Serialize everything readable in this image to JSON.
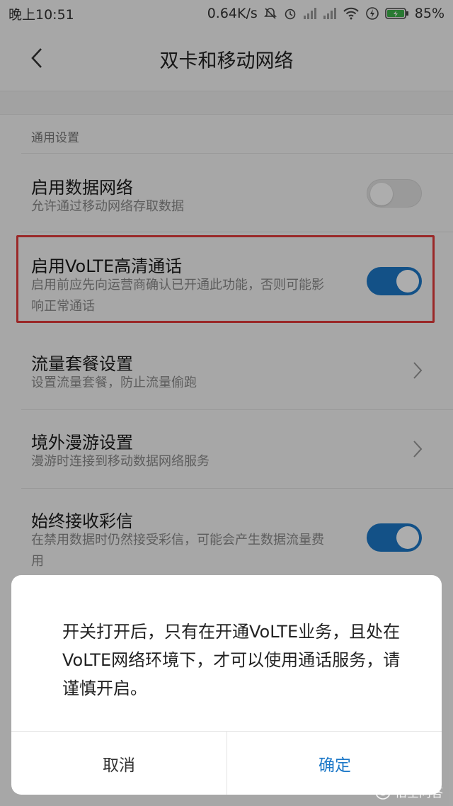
{
  "status_bar": {
    "time": "晚上10:51",
    "net_speed": "0.64K/s",
    "battery": "85%",
    "icons": [
      "mute-icon",
      "alarm-icon",
      "signal-icon",
      "signal-icon",
      "wifi-icon",
      "flash-icon",
      "battery-charging-icon"
    ]
  },
  "header": {
    "title": "双卡和移动网络",
    "back_icon": "chevron-left-icon"
  },
  "section": {
    "label": "通用设置"
  },
  "settings": {
    "data_network": {
      "title": "启用数据网络",
      "subtitle": "允许通过移动网络存取数据",
      "enabled": false
    },
    "volte": {
      "title": "启用VoLTE高清通话",
      "subtitle": "启用前应先向运营商确认已开通此功能，否则可能影响正常通话",
      "enabled": true
    },
    "data_plan": {
      "title": "流量套餐设置",
      "subtitle": "设置流量套餐，防止流量偷跑"
    },
    "roaming": {
      "title": "境外漫游设置",
      "subtitle": "漫游时连接到移动数据网络服务"
    },
    "mms": {
      "title": "始终接收彩信",
      "subtitle": "在禁用数据时仍然接受彩信，可能会产生数据流量费用",
      "enabled": true
    }
  },
  "dialog": {
    "message": "开关打开后，只有在开通VoLTE业务，且处在VoLTE网络环境下，才可以使用通话服务，请谨慎开启。",
    "cancel_label": "取消",
    "confirm_label": "确定"
  },
  "watermark": {
    "text": "悟空问答"
  },
  "colors": {
    "accent": "#1c78c8",
    "highlight": "#e33b3b",
    "toggle_off": "#e3e3e3"
  }
}
